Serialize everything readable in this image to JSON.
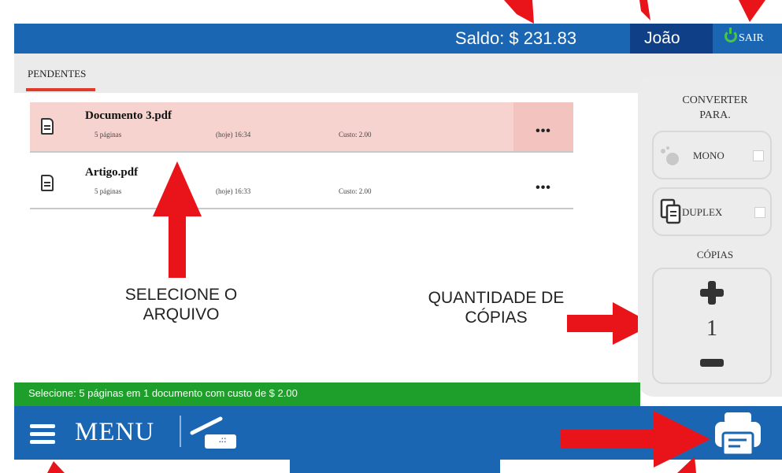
{
  "header": {
    "balance": "Saldo: $ 231.83",
    "user": "João",
    "logout_label": "SAIR"
  },
  "tabs": {
    "active": "PENDENTES"
  },
  "files": [
    {
      "name": "Documento 3.pdf",
      "pages": "5 páginas",
      "date": "(hoje) 16:34",
      "cost": "Custo: 2.00",
      "selected": true
    },
    {
      "name": "Artigo.pdf",
      "pages": "5 páginas",
      "date": "(hoje) 16:33",
      "cost": "Custo: 2.00",
      "selected": false
    }
  ],
  "row_menu_label": "•••",
  "annotations": {
    "select_file_line1": "SELECIONE O",
    "select_file_line2": "ARQUIVO",
    "copies_line1": "QUANTIDADE DE",
    "copies_line2": "CÓPIAS"
  },
  "panel": {
    "convert_line1": "CONVERTER",
    "convert_line2": "PARA.",
    "mono_label": "MONO",
    "duplex_label": "DUPLEX",
    "copies_title": "CÓPIAS",
    "copies_value": "1"
  },
  "status": {
    "text": "Selecione: 5 páginas em 1 documento com custo de $ 2.00"
  },
  "footer": {
    "menu_label": "MENU",
    "scanner_badge": ".::"
  },
  "icons": {
    "menu": "hamburger-icon",
    "scanner": "scanner-icon",
    "print": "printer-icon",
    "power": "power-icon",
    "file": "file-icon"
  },
  "colors": {
    "primary_blue": "#1a66b3",
    "dark_blue": "#0f3f86",
    "status_green": "#1e9e2b",
    "selected_row": "#f7d3cf",
    "annotation_red": "#e8141a"
  }
}
